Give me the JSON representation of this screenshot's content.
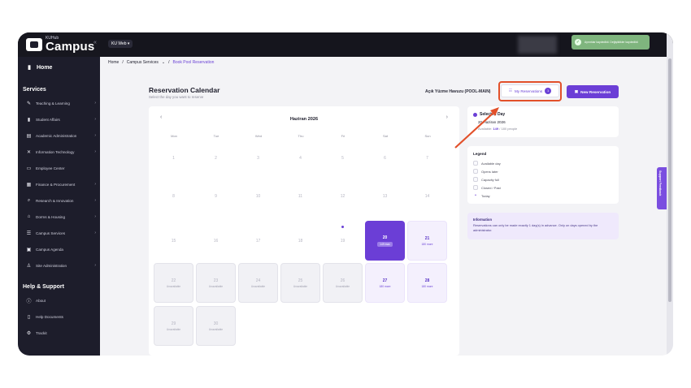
{
  "app": {
    "logo_small": "KUHub",
    "logo_big": "Campus",
    "web_label": "KU Web ▾",
    "toast": "Ayrıntılar kaydedildi. Değişiklikler kaydedildi."
  },
  "sidebar": {
    "home": "Home",
    "services_title": "Services",
    "services": [
      {
        "label": "Teaching & Learning",
        "icon": "pencil-icon",
        "glyph": "✎",
        "chev": true
      },
      {
        "label": "Student Affairs",
        "icon": "card-icon",
        "glyph": "▮",
        "chev": true
      },
      {
        "label": "Academic Administration",
        "icon": "building-icon",
        "glyph": "▤",
        "chev": true
      },
      {
        "label": "Information Technology",
        "icon": "tools-icon",
        "glyph": "✕",
        "chev": true
      },
      {
        "label": "Employee Center",
        "icon": "briefcase-icon",
        "glyph": "▭",
        "chev": false
      },
      {
        "label": "Finance & Procurement",
        "icon": "calculator-icon",
        "glyph": "▦",
        "chev": true
      },
      {
        "label": "Research & Innovation",
        "icon": "search-icon",
        "glyph": "⌕",
        "chev": true
      },
      {
        "label": "Dorms & Housing",
        "icon": "house-icon",
        "glyph": "⌂",
        "chev": true
      },
      {
        "label": "Campus Services",
        "icon": "list-icon",
        "glyph": "☰",
        "chev": true
      },
      {
        "label": "Campus Agenda",
        "icon": "calendar-icon",
        "glyph": "▣",
        "chev": false
      },
      {
        "label": "Site Administration",
        "icon": "users-icon",
        "glyph": "♙",
        "chev": true
      }
    ],
    "help_title": "Help & Support",
    "help": [
      {
        "label": "About",
        "icon": "info-icon",
        "glyph": "ⓘ"
      },
      {
        "label": "Help Documents",
        "icon": "document-icon",
        "glyph": "▯"
      },
      {
        "label": "Trackit",
        "icon": "gear-icon",
        "glyph": "⚙"
      }
    ]
  },
  "breadcrumb": {
    "home": "Home",
    "sep1": "/",
    "services": "Campus Services",
    "chev": "⌄",
    "sep2": "/",
    "current": "Book Pool Reservation"
  },
  "header": {
    "title": "Reservation Calendar",
    "subtitle": "Select the day you want to reserve",
    "pool": "Açık Yüzme Havuzu (POOL-MAIN)",
    "my_reservations": "My Reservations",
    "my_reservations_count": "1",
    "new_reservation": "New Reservation"
  },
  "calendar": {
    "prev": "‹",
    "next": "›",
    "month": "Haziran 2026",
    "weekdays": [
      "Mon",
      "Tue",
      "Wed",
      "Thu",
      "Fri",
      "Sat",
      "Sun"
    ],
    "days": [
      {
        "num": "1",
        "state": "past"
      },
      {
        "num": "2",
        "state": "past"
      },
      {
        "num": "3",
        "state": "past"
      },
      {
        "num": "4",
        "state": "past"
      },
      {
        "num": "5",
        "state": "past"
      },
      {
        "num": "6",
        "state": "past"
      },
      {
        "num": "7",
        "state": "past"
      },
      {
        "num": "8",
        "state": "past"
      },
      {
        "num": "9",
        "state": "past"
      },
      {
        "num": "10",
        "state": "past"
      },
      {
        "num": "11",
        "state": "past"
      },
      {
        "num": "12",
        "state": "past"
      },
      {
        "num": "13",
        "state": "past"
      },
      {
        "num": "14",
        "state": "past"
      },
      {
        "num": "15",
        "state": "past"
      },
      {
        "num": "16",
        "state": "past"
      },
      {
        "num": "17",
        "state": "past"
      },
      {
        "num": "18",
        "state": "past"
      },
      {
        "num": "19",
        "state": "today"
      },
      {
        "num": "20",
        "state": "selected",
        "sub": "149 max"
      },
      {
        "num": "21",
        "state": "avail",
        "sub": "180 more"
      },
      {
        "num": "22",
        "state": "unavail",
        "sub": "Unavailable"
      },
      {
        "num": "23",
        "state": "unavail",
        "sub": "Unavailable"
      },
      {
        "num": "24",
        "state": "unavail",
        "sub": "Unavailable"
      },
      {
        "num": "25",
        "state": "unavail",
        "sub": "Unavailable"
      },
      {
        "num": "26",
        "state": "unavail",
        "sub": "Unavailable"
      },
      {
        "num": "27",
        "state": "avail",
        "sub": "180 more"
      },
      {
        "num": "28",
        "state": "avail",
        "sub": "180 more"
      },
      {
        "num": "29",
        "state": "unavail",
        "sub": "Unavailable"
      },
      {
        "num": "30",
        "state": "unavail",
        "sub": "Unavailable"
      }
    ]
  },
  "selected": {
    "title": "Selected Day",
    "date": "20 Haziran 2026",
    "cap_label": "Available:",
    "cap_value": "149",
    "cap_total": "/ 180 people"
  },
  "legend": {
    "title": "Legend",
    "items": [
      {
        "label": "Available day",
        "kind": "box"
      },
      {
        "label": "Opens later",
        "kind": "box"
      },
      {
        "label": "Capacity full",
        "kind": "box"
      },
      {
        "label": "Closed / Past",
        "kind": "box"
      },
      {
        "label": "Today",
        "kind": "dot"
      }
    ]
  },
  "info": {
    "title": "Information",
    "text": "Reservations can only be made exactly 1 day(s) in advance. Only on days opened by the administrator."
  },
  "feedback": "Support Feedback",
  "colors": {
    "accent": "#6b3ed6",
    "highlight": "#e2502a",
    "sidebar": "#1d1d2b"
  }
}
